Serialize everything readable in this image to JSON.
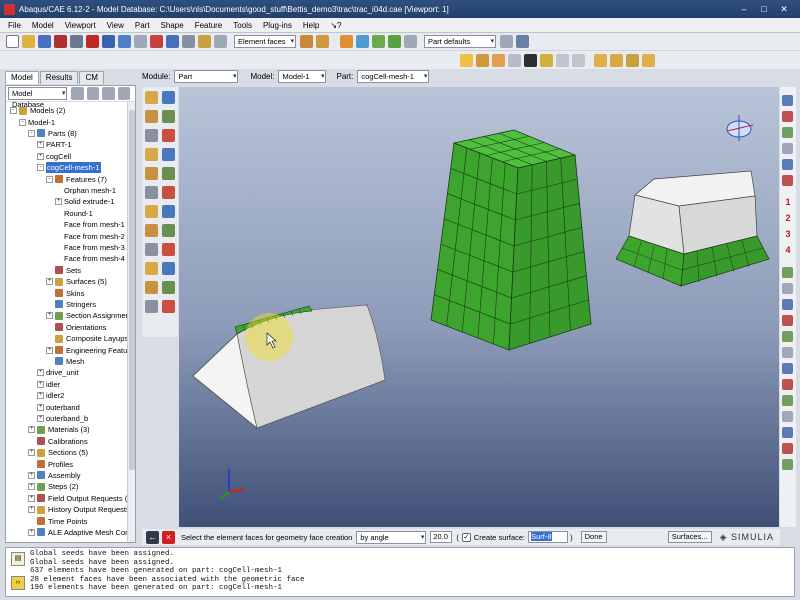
{
  "window": {
    "title": "Abaqus/CAE 6.12-2 - Model Database: C:\\Users\\nls\\Documents\\good_stuff\\Bettis_demo3\\trac\\trac_i04d.cae [Viewport: 1]"
  },
  "menu": [
    "File",
    "Model",
    "Viewport",
    "View",
    "Part",
    "Shape",
    "Feature",
    "Tools",
    "Plug-ins",
    "Help",
    "↘?"
  ],
  "toolbar": {
    "selection_filter": "Element faces",
    "part_defaults": "Part defaults"
  },
  "tabs": [
    "Model",
    "Results",
    "CM"
  ],
  "tree": {
    "dropdown": "Model Database",
    "rows": [
      {
        "indent": 0,
        "exp": "-",
        "icon": "models-icon",
        "label": "Models (2)"
      },
      {
        "indent": 1,
        "exp": "-",
        "icon": "",
        "label": "Model-1"
      },
      {
        "indent": 2,
        "exp": "-",
        "icon": "parts-icon",
        "label": "Parts (8)"
      },
      {
        "indent": 3,
        "exp": "+",
        "icon": "",
        "label": "PART-1"
      },
      {
        "indent": 3,
        "exp": "+",
        "icon": "",
        "label": "cogCell"
      },
      {
        "indent": 3,
        "exp": "-",
        "icon": "",
        "label": "cogCell-mesh-1",
        "selected": true
      },
      {
        "indent": 4,
        "exp": "-",
        "icon": "features-icon",
        "label": "Features (7)"
      },
      {
        "indent": 5,
        "exp": "",
        "icon": "",
        "label": "Orphan mesh-1"
      },
      {
        "indent": 5,
        "exp": "+",
        "icon": "",
        "label": "Solid extrude-1"
      },
      {
        "indent": 5,
        "exp": "",
        "icon": "",
        "label": "Round-1"
      },
      {
        "indent": 5,
        "exp": "",
        "icon": "",
        "label": "Face from mesh-1"
      },
      {
        "indent": 5,
        "exp": "",
        "icon": "",
        "label": "Face from mesh-2"
      },
      {
        "indent": 5,
        "exp": "",
        "icon": "",
        "label": "Face from mesh-3"
      },
      {
        "indent": 5,
        "exp": "",
        "icon": "",
        "label": "Face from mesh-4"
      },
      {
        "indent": 4,
        "exp": "",
        "icon": "sets-icon",
        "label": "Sets"
      },
      {
        "indent": 4,
        "exp": "+",
        "icon": "surfaces-icon",
        "label": "Surfaces (5)"
      },
      {
        "indent": 4,
        "exp": "",
        "icon": "skins-icon",
        "label": "Skins"
      },
      {
        "indent": 4,
        "exp": "",
        "icon": "stringers-icon",
        "label": "Stringers"
      },
      {
        "indent": 4,
        "exp": "+",
        "icon": "section-icon",
        "label": "Section Assignmer"
      },
      {
        "indent": 4,
        "exp": "",
        "icon": "orientations-icon",
        "label": "Orientations"
      },
      {
        "indent": 4,
        "exp": "",
        "icon": "layups-icon",
        "label": "Composite Layups"
      },
      {
        "indent": 4,
        "exp": "+",
        "icon": "eng-features-icon",
        "label": "Engineering Featu"
      },
      {
        "indent": 4,
        "exp": "",
        "icon": "mesh-icon",
        "label": "Mesh"
      },
      {
        "indent": 3,
        "exp": "+",
        "icon": "",
        "label": "drive_unit"
      },
      {
        "indent": 3,
        "exp": "+",
        "icon": "",
        "label": "idler"
      },
      {
        "indent": 3,
        "exp": "+",
        "icon": "",
        "label": "idler2"
      },
      {
        "indent": 3,
        "exp": "+",
        "icon": "",
        "label": "outerband"
      },
      {
        "indent": 3,
        "exp": "+",
        "icon": "",
        "label": "outerband_b"
      },
      {
        "indent": 2,
        "exp": "+",
        "icon": "materials-icon",
        "label": "Materials (3)"
      },
      {
        "indent": 2,
        "exp": "",
        "icon": "calibrations-icon",
        "label": "Calibrations"
      },
      {
        "indent": 2,
        "exp": "+",
        "icon": "sections-icon",
        "label": "Sections (5)"
      },
      {
        "indent": 2,
        "exp": "",
        "icon": "profiles-icon",
        "label": "Profiles"
      },
      {
        "indent": 2,
        "exp": "+",
        "icon": "assembly-icon",
        "label": "Assembly"
      },
      {
        "indent": 2,
        "exp": "+",
        "icon": "steps-icon",
        "label": "Steps (2)"
      },
      {
        "indent": 2,
        "exp": "+",
        "icon": "field-output-icon",
        "label": "Field Output Requests (2)"
      },
      {
        "indent": 2,
        "exp": "+",
        "icon": "history-output-icon",
        "label": "History Output Requests (1)"
      },
      {
        "indent": 2,
        "exp": "",
        "icon": "time-points-icon",
        "label": "Time Points"
      },
      {
        "indent": 2,
        "exp": "+",
        "icon": "ale-icon",
        "label": "ALE Adaptive Mesh Cons"
      }
    ]
  },
  "context": {
    "module_label": "Module:",
    "module_value": "Part",
    "model_label": "Model:",
    "model_value": "Model-1",
    "part_label": "Part:",
    "part_value": "cogCell-mesh-1"
  },
  "right_numbers": [
    "1",
    "2",
    "3",
    "4"
  ],
  "prompt": {
    "text": "Select the element faces for geometry face creation",
    "method": "by angle",
    "angle": "20.0",
    "create_surface_label": "Create surface:",
    "surface_name": "Surf-8",
    "done": "Done",
    "surfaces_button": "Surfaces..."
  },
  "brand": "SIMULIA",
  "messages": [
    "Global seeds have been assigned.",
    "Global seeds have been assigned.",
    "637 elements have been generated on part: cogCell-mesh-1",
    "28 element faces have been associated with the geometric face",
    "196 elements have been generated on part: cogCell-mesh-1"
  ],
  "colors": {
    "mesh_green": "#3da52e",
    "mesh_line": "#1a3a14",
    "selected": "#3370d0",
    "highlight": "#f0e020"
  }
}
